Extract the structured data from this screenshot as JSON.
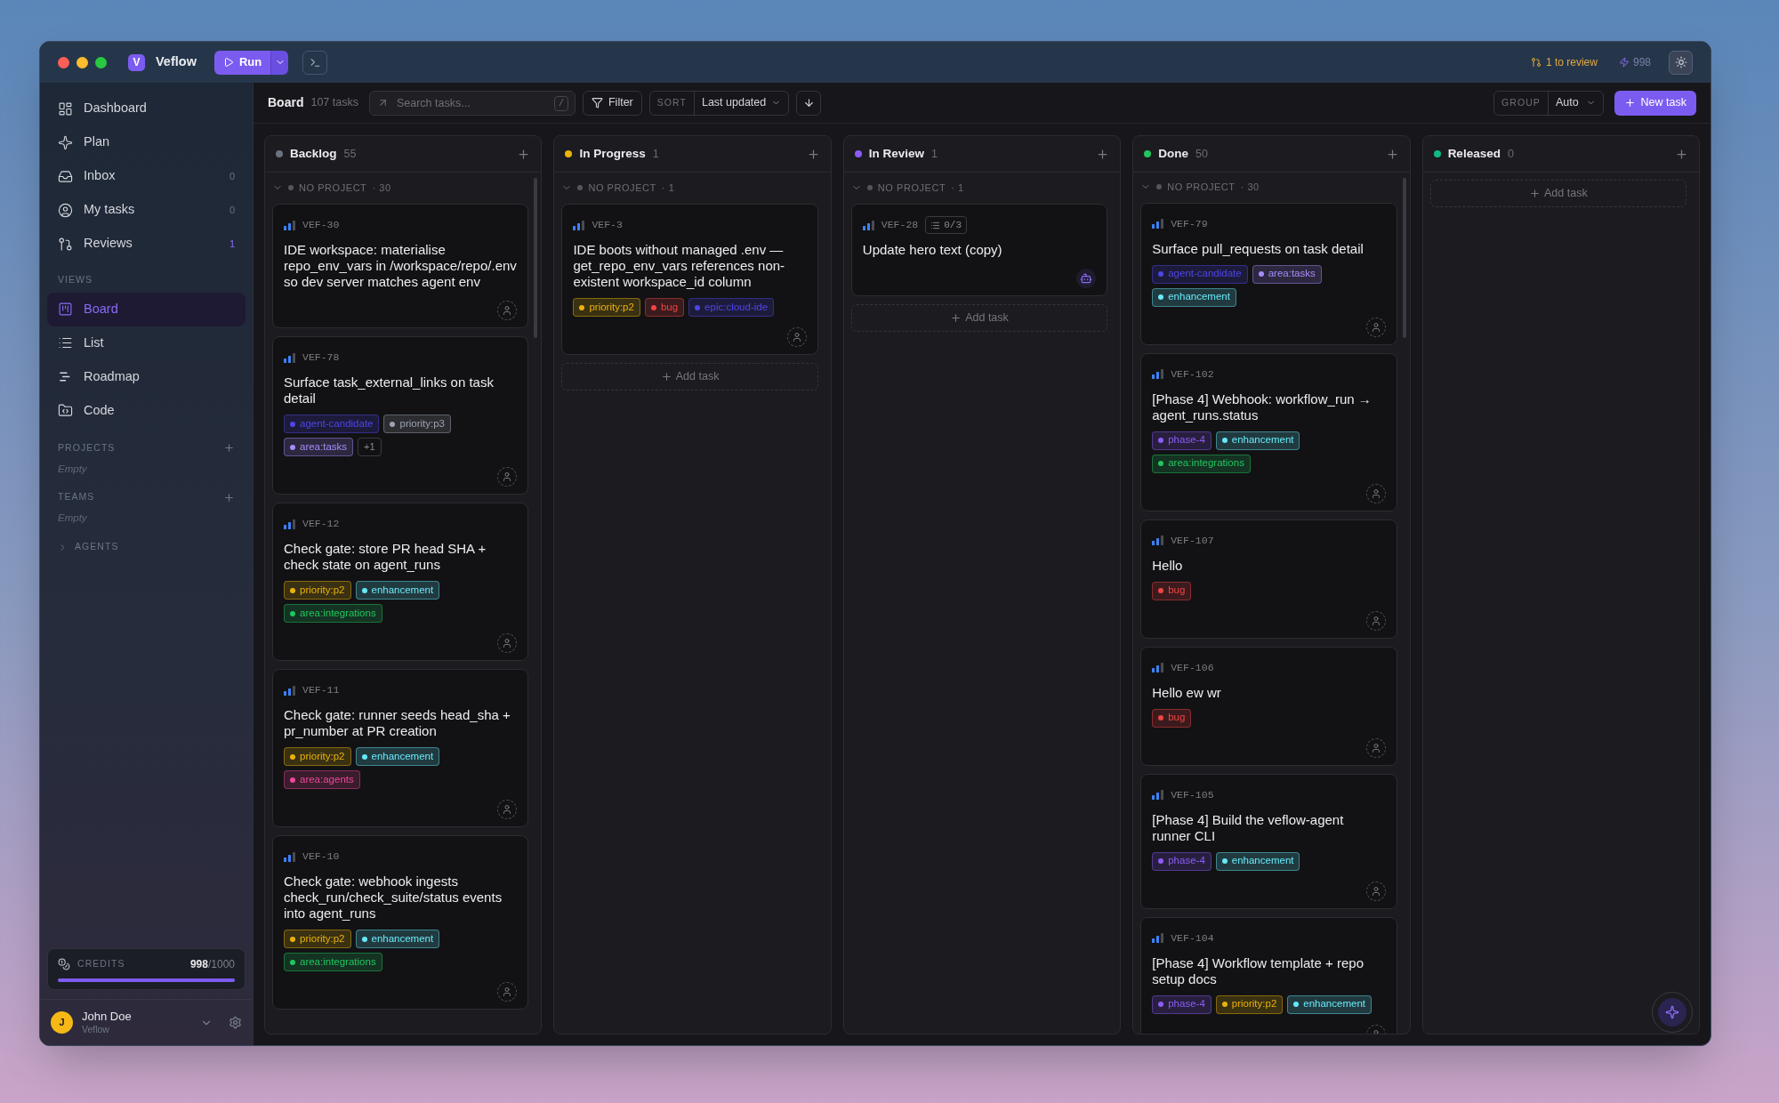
{
  "app": {
    "name": "Veflow",
    "logo_letter": "V"
  },
  "toolbar_top": {
    "run_label": "Run",
    "review_label": "1 to review",
    "credits_label": "998"
  },
  "sidebar": {
    "items": [
      {
        "label": "Dashboard",
        "selected": false
      },
      {
        "label": "Plan",
        "selected": false
      },
      {
        "label": "Inbox",
        "count": "0",
        "highlighted": false,
        "selected": false
      },
      {
        "label": "My tasks",
        "count": "0",
        "highlighted": false,
        "selected": false
      },
      {
        "label": "Reviews",
        "count": "1",
        "highlighted": true,
        "selected": false
      }
    ],
    "views_title": "VIEWS",
    "views": [
      {
        "label": "Board",
        "selected": true
      },
      {
        "label": "List",
        "selected": false
      },
      {
        "label": "Roadmap",
        "selected": false
      },
      {
        "label": "Code",
        "selected": false
      }
    ],
    "sections": [
      {
        "title": "PROJECTS",
        "empty": "Empty"
      },
      {
        "title": "TEAMS",
        "empty": "Empty"
      }
    ],
    "agents": {
      "title": "AGENTS",
      "expanded": false
    },
    "credits": {
      "label": "CREDITS",
      "value": "**998**/1000",
      "level": 0.998
    },
    "user": {
      "initial": "J",
      "name": "John Doe",
      "org": "Veflow"
    }
  },
  "board_bar": {
    "title": "Board",
    "count": "107 tasks",
    "search_placeholder": "Search tasks...",
    "search_key": "/",
    "filter_label": "Filter",
    "sort_label": "SORT",
    "sort_value": "Last updated",
    "group_label": "GROUP",
    "group_value": "Auto",
    "new_task_label": "New task"
  },
  "columns": [
    {
      "name": "Backlog",
      "count": "55",
      "color": "#6b7280",
      "groups": [
        {
          "name": "NO PROJECT",
          "count": "· 30",
          "expanded": true,
          "cards": [
            {
              "kind": "unassigned",
              "id": "VEF-30",
              "title": "IDE workspace: materialise repo_env_vars in /workspace/repo/.env so dev server matches agent env"
            },
            {
              "kind": "unassigned",
              "id": "VEF-78",
              "title": "Surface task_external_links on task detail",
              "tags": [
                {
                  "kind": "label",
                  "label": "agent-candidate",
                  "color": "#4f46e5"
                },
                {
                  "kind": "label",
                  "label": "priority:p3",
                  "color": "#9ca3af"
                },
                {
                  "kind": "label",
                  "label": "area:tasks",
                  "color": "#a78bfa"
                },
                {
                  "kind": "more",
                  "label": "+1"
                }
              ]
            },
            {
              "kind": "unassigned",
              "id": "VEF-12",
              "title": "Check gate: store PR head SHA + check state on agent_runs",
              "tags": [
                {
                  "kind": "label",
                  "label": "priority:p2",
                  "color": "#eab308"
                },
                {
                  "kind": "label",
                  "label": "enhancement",
                  "color": "#67e8f9"
                },
                {
                  "kind": "label",
                  "label": "area:integrations",
                  "color": "#22c55e"
                }
              ]
            },
            {
              "kind": "unassigned",
              "id": "VEF-11",
              "title": "Check gate: runner seeds head_sha + pr_number at PR creation",
              "tags": [
                {
                  "kind": "label",
                  "label": "priority:p2",
                  "color": "#eab308"
                },
                {
                  "kind": "label",
                  "label": "enhancement",
                  "color": "#67e8f9"
                },
                {
                  "kind": "label",
                  "label": "area:agents",
                  "color": "#ec4899"
                }
              ]
            },
            {
              "kind": "unassigned",
              "id": "VEF-10",
              "title": "Check gate: webhook ingests check_run/check_suite/status events into agent_runs",
              "tags": [
                {
                  "kind": "label",
                  "label": "priority:p2",
                  "color": "#eab308"
                },
                {
                  "kind": "label",
                  "label": "enhancement",
                  "color": "#67e8f9"
                },
                {
                  "kind": "label",
                  "label": "area:integrations",
                  "color": "#22c55e"
                }
              ]
            }
          ]
        }
      ]
    },
    {
      "name": "In Progress",
      "count": "1",
      "color": "#eab308",
      "add_task": "Add task",
      "groups": [
        {
          "name": "NO PROJECT",
          "count": "· 1",
          "expanded": true,
          "cards": [
            {
              "kind": "unassigned",
              "id": "VEF-3",
              "title": "IDE boots without managed .env — get_repo_env_vars references non-existent workspace_id column",
              "tags": [
                {
                  "kind": "label",
                  "label": "priority:p2",
                  "color": "#eab308"
                },
                {
                  "kind": "label",
                  "label": "bug",
                  "color": "#ef4444"
                },
                {
                  "kind": "label",
                  "label": "epic:cloud-ide",
                  "color": "#4f46e5"
                }
              ]
            }
          ]
        }
      ]
    },
    {
      "name": "In Review",
      "count": "1",
      "color": "#8b5cf6",
      "add_task": "Add task",
      "groups": [
        {
          "name": "NO PROJECT",
          "count": "· 1",
          "expanded": true,
          "cards": [
            {
              "kind": "agent",
              "id": "VEF-28",
              "subtasks": "0/3",
              "title": "Update hero text (copy)"
            }
          ]
        }
      ]
    },
    {
      "name": "Done",
      "count": "50",
      "color": "#22c55e",
      "groups": [
        {
          "name": "NO PROJECT",
          "count": "· 30",
          "expanded": true,
          "cards": [
            {
              "kind": "unassigned",
              "id": "VEF-79",
              "title": "Surface pull_requests on task detail",
              "tags": [
                {
                  "kind": "label",
                  "label": "agent-candidate",
                  "color": "#4f46e5"
                },
                {
                  "kind": "label",
                  "label": "area:tasks",
                  "color": "#a78bfa"
                },
                {
                  "kind": "label",
                  "label": "enhancement",
                  "color": "#67e8f9"
                }
              ]
            },
            {
              "kind": "unassigned",
              "id": "VEF-102",
              "title": "[Phase 4] Webhook: workflow_run → agent_runs.status",
              "tags": [
                {
                  "kind": "label",
                  "label": "phase-4",
                  "color": "#8b5cf6"
                },
                {
                  "kind": "label",
                  "label": "enhancement",
                  "color": "#67e8f9"
                },
                {
                  "kind": "label",
                  "label": "area:integrations",
                  "color": "#22c55e"
                }
              ]
            },
            {
              "kind": "unassigned",
              "id": "VEF-107",
              "title": "Hello",
              "tags": [
                {
                  "kind": "label",
                  "label": "bug",
                  "color": "#ef4444"
                }
              ]
            },
            {
              "kind": "unassigned",
              "id": "VEF-106",
              "title": "Hello ew wr",
              "tags": [
                {
                  "kind": "label",
                  "label": "bug",
                  "color": "#ef4444"
                }
              ]
            },
            {
              "kind": "unassigned",
              "id": "VEF-105",
              "title": "[Phase 4] Build the veflow-agent runner CLI",
              "tags": [
                {
                  "kind": "label",
                  "label": "phase-4",
                  "color": "#8b5cf6"
                },
                {
                  "kind": "label",
                  "label": "enhancement",
                  "color": "#67e8f9"
                }
              ]
            },
            {
              "kind": "unassigned",
              "id": "VEF-104",
              "title": "[Phase 4] Workflow template + repo setup docs",
              "tags": [
                {
                  "kind": "label",
                  "label": "phase-4",
                  "color": "#8b5cf6"
                },
                {
                  "kind": "label",
                  "label": "priority:p2",
                  "color": "#eab308"
                },
                {
                  "kind": "label",
                  "label": "enhancement",
                  "color": "#67e8f9"
                }
              ]
            }
          ]
        }
      ]
    },
    {
      "name": "Released",
      "count": "0",
      "color": "#10b981",
      "add_task": "Add task"
    }
  ]
}
